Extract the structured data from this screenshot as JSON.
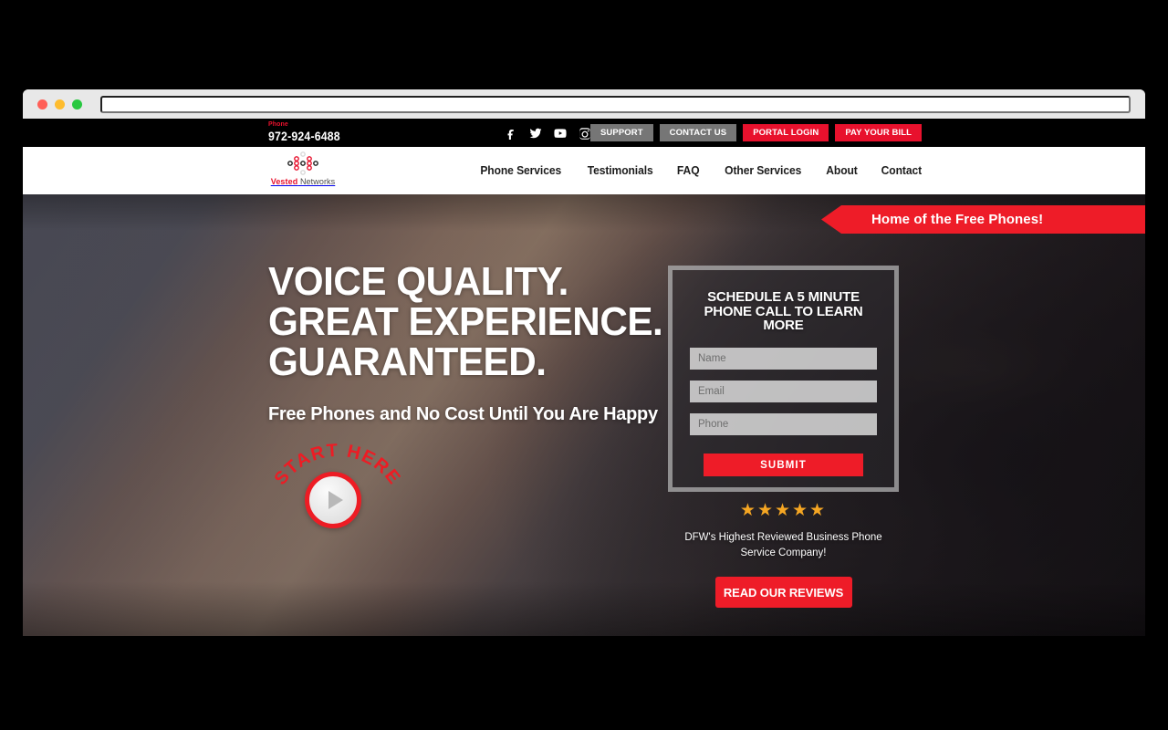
{
  "browser": {
    "traffic_lights": [
      "close",
      "minimize",
      "maximize"
    ],
    "url_value": "",
    "url_placeholder": ""
  },
  "topbar": {
    "phone_label": "Phone",
    "phone_number": "972-924-6488",
    "socials": [
      {
        "name": "facebook-icon",
        "label": "Facebook"
      },
      {
        "name": "twitter-icon",
        "label": "Twitter"
      },
      {
        "name": "youtube-icon",
        "label": "YouTube"
      },
      {
        "name": "instagram-icon",
        "label": "Instagram"
      }
    ],
    "buttons": [
      {
        "label": "SUPPORT",
        "style": "gray"
      },
      {
        "label": "CONTACT US",
        "style": "gray"
      },
      {
        "label": "PORTAL LOGIN",
        "style": "red"
      },
      {
        "label": "PAY YOUR BILL",
        "style": "red"
      }
    ]
  },
  "header": {
    "logo": {
      "brand": "Vested",
      "suffix": " Networks"
    },
    "nav": [
      {
        "label": "Phone Services"
      },
      {
        "label": "Testimonials"
      },
      {
        "label": "FAQ"
      },
      {
        "label": "Other Services"
      },
      {
        "label": "About"
      },
      {
        "label": "Contact"
      }
    ]
  },
  "hero": {
    "ribbon": "Home of the Free Phones!",
    "headline_line1": "VOICE QUALITY.",
    "headline_line2": "GREAT EXPERIENCE.",
    "headline_line3": "GUARANTEED.",
    "subhead": "Free Phones and No Cost Until You Are Happy",
    "start_here": "START HERE"
  },
  "form": {
    "title_line1": "SCHEDULE A 5 MINUTE",
    "title_line2": "PHONE CALL TO LEARN MORE",
    "name_placeholder": "Name",
    "name_value": "",
    "email_placeholder": "Email",
    "email_value": "",
    "phone_placeholder": "Phone",
    "phone_value": "",
    "submit_label": "SUBMIT"
  },
  "reviews": {
    "stars": "★★★★★",
    "star_count": 5,
    "text": "DFW's Highest Reviewed Business Phone Service Company!",
    "button_label": "READ OUR REVIEWS"
  },
  "colors": {
    "brand_red": "#e8112d",
    "button_red": "#ee1c28",
    "gray_button": "#767676",
    "star_amber": "#f5a623",
    "topbar_bg": "#000000"
  }
}
